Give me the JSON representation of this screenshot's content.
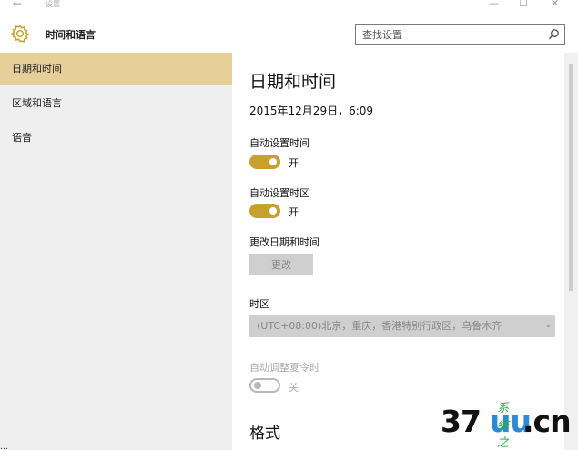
{
  "window": {
    "back_glyph": "←",
    "app_title": "设置",
    "minimize_glyph": "—",
    "maximize_glyph": "☐",
    "close_glyph": "✕"
  },
  "header": {
    "title": "时间和语言",
    "icon": "gear-icon",
    "search_placeholder": "查找设置",
    "search_icon": "search-icon"
  },
  "sidebar": {
    "items": [
      {
        "label": "日期和时间",
        "active": true
      },
      {
        "label": "区域和语言",
        "active": false
      },
      {
        "label": "语音",
        "active": false
      }
    ]
  },
  "main": {
    "title": "日期和时间",
    "current_datetime": "2015年12月29日，6:09",
    "auto_time": {
      "label": "自动设置时间",
      "state_text": "开",
      "on": true
    },
    "auto_timezone": {
      "label": "自动设置时区",
      "state_text": "开",
      "on": true
    },
    "change_datetime": {
      "label": "更改日期和时间",
      "button_label": "更改"
    },
    "timezone": {
      "label": "时区",
      "selected": "(UTC+08:00)北京，重庆，香港特别行政区，乌鲁木齐",
      "chevron": "⌄"
    },
    "dst": {
      "label": "自动调整夏令时",
      "state_text": "关",
      "on": false
    },
    "format_section_title": "格式"
  },
  "watermark": {
    "digits": "37",
    "uu": "uu",
    "tld": ".cn",
    "hanzi": "系统之家"
  },
  "bottom_caption": "…"
}
